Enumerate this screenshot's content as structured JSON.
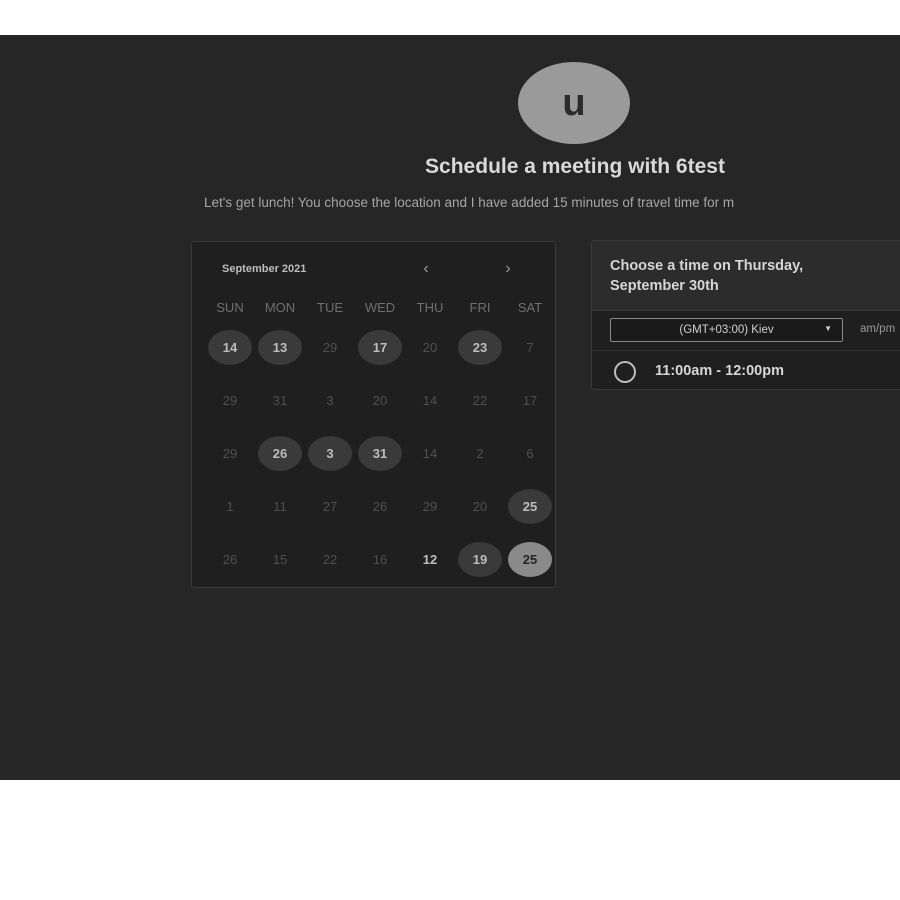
{
  "header": {
    "avatar_letter": "u",
    "title": "Schedule a meeting with 6test",
    "description": "Let's get lunch! You choose the location and I have added 15 minutes of travel time for m"
  },
  "calendar": {
    "month_label": "September 2021",
    "prev_icon": "‹",
    "next_icon": "›",
    "weekdays": [
      "SUN",
      "MON",
      "TUE",
      "WED",
      "THU",
      "FRI",
      "SAT"
    ],
    "weeks": [
      [
        {
          "d": "14",
          "s": "avail"
        },
        {
          "d": "13",
          "s": "avail"
        },
        {
          "d": "29",
          "s": ""
        },
        {
          "d": "17",
          "s": "avail"
        },
        {
          "d": "20",
          "s": ""
        },
        {
          "d": "23",
          "s": "avail"
        },
        {
          "d": "7",
          "s": ""
        }
      ],
      [
        {
          "d": "29",
          "s": ""
        },
        {
          "d": "31",
          "s": ""
        },
        {
          "d": "3",
          "s": ""
        },
        {
          "d": "20",
          "s": ""
        },
        {
          "d": "14",
          "s": ""
        },
        {
          "d": "22",
          "s": ""
        },
        {
          "d": "17",
          "s": ""
        }
      ],
      [
        {
          "d": "29",
          "s": ""
        },
        {
          "d": "26",
          "s": "avail"
        },
        {
          "d": "3",
          "s": "avail"
        },
        {
          "d": "31",
          "s": "avail"
        },
        {
          "d": "14",
          "s": ""
        },
        {
          "d": "2",
          "s": ""
        },
        {
          "d": "6",
          "s": ""
        }
      ],
      [
        {
          "d": "1",
          "s": ""
        },
        {
          "d": "11",
          "s": ""
        },
        {
          "d": "27",
          "s": ""
        },
        {
          "d": "26",
          "s": ""
        },
        {
          "d": "29",
          "s": ""
        },
        {
          "d": "20",
          "s": ""
        },
        {
          "d": "25",
          "s": "avail"
        }
      ],
      [
        {
          "d": "26",
          "s": ""
        },
        {
          "d": "15",
          "s": ""
        },
        {
          "d": "22",
          "s": ""
        },
        {
          "d": "16",
          "s": ""
        },
        {
          "d": "12",
          "s": "bold"
        },
        {
          "d": "19",
          "s": "avail"
        },
        {
          "d": "25",
          "s": "avail sel"
        }
      ]
    ]
  },
  "time_panel": {
    "heading": "Choose a time on Thursday, September 30th",
    "timezone": "(GMT+03:00) Kiev",
    "caret_icon": "▼",
    "format_toggle": "am/pm",
    "slots": [
      "11:00am - 12:00pm"
    ]
  },
  "colors": {
    "background": "#262626",
    "panel": "#1f1f1f",
    "available_day": "#3a3a3a",
    "selected_day": "#8a8a8a"
  }
}
